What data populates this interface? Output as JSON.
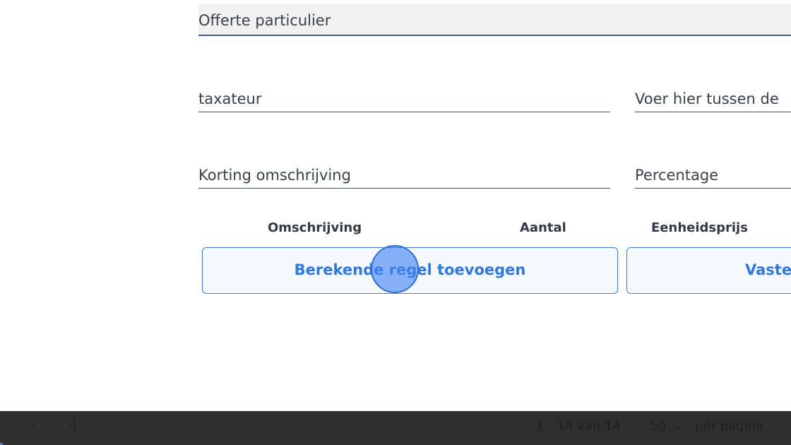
{
  "form": {
    "title_value": "Offerte particulier",
    "taxateur_value": "taxateur",
    "tussen_placeholder": "Voer hier tussen de",
    "korting_placeholder": "Korting omschrijving",
    "percentage_placeholder": "Percentage"
  },
  "table": {
    "headers": [
      "Omschrijving",
      "Aantal",
      "Eenheidsprijs"
    ]
  },
  "buttons": {
    "berekende": "Berekende regel toevoegen",
    "vaste": "Vaste"
  },
  "pagination": {
    "next_icon": "›",
    "last_icon": "›|",
    "range": "1 - 14 van 14",
    "per_page_value": "50",
    "per_page_chevron": "⌄",
    "per_page_label": "per pagina"
  },
  "colors": {
    "accent": "#2f78de",
    "footer_bg": "#2f2f2f"
  }
}
